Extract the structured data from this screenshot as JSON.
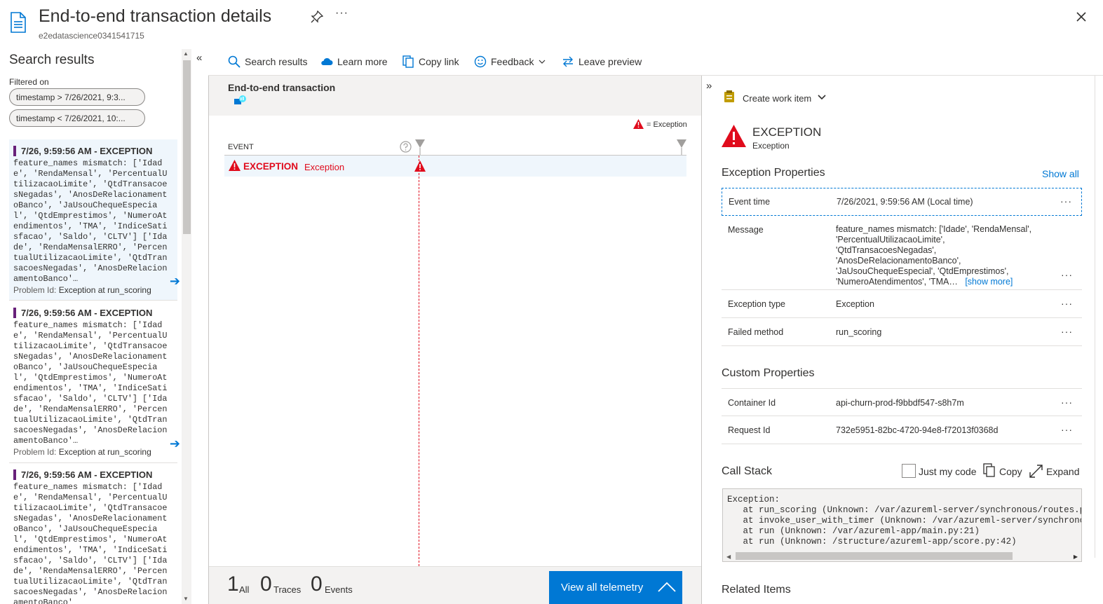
{
  "header": {
    "title": "End-to-end transaction details",
    "subtitle": "e2edatascience0341541715"
  },
  "left_panel": {
    "title": "Search results",
    "filtered_on": "Filtered on",
    "filters": [
      "timestamp > 7/26/2021, 9:3...",
      "timestamp < 7/26/2021, 10:..."
    ],
    "results": [
      {
        "header": "7/26, 9:59:56 AM - EXCEPTION",
        "body": "feature_names mismatch: ['Idad\ne', 'RendaMensal', 'PercentualU\ntilizacaoLimite', 'QtdTransacoe\nsNegadas', 'AnosDeRelacionament\noBanco', 'JaUsouChequeEspecia\nl', 'QtdEmprestimos', 'NumeroAt\nendimentos', 'TMA', 'IndiceSati\nsfacao', 'Saldo', 'CLTV'] ['Ida\nde', 'RendaMensalERRO', 'Percen\ntualUtilizacaoLimite', 'QtdTran\nsacoesNegadas', 'AnosDeRelacion\namentoBanco'…",
        "problem_label": "Problem Id:",
        "problem_value": "Exception at run_scoring"
      },
      {
        "header": "7/26, 9:59:56 AM - EXCEPTION",
        "body": "feature_names mismatch: ['Idad\ne', 'RendaMensal', 'PercentualU\ntilizacaoLimite', 'QtdTransacoe\nsNegadas', 'AnosDeRelacionament\noBanco', 'JaUsouChequeEspecia\nl', 'QtdEmprestimos', 'NumeroAt\nendimentos', 'TMA', 'IndiceSati\nsfacao', 'Saldo', 'CLTV'] ['Ida\nde', 'RendaMensalERRO', 'Percen\ntualUtilizacaoLimite', 'QtdTran\nsacoesNegadas', 'AnosDeRelacion\namentoBanco'…",
        "problem_label": "Problem Id:",
        "problem_value": "Exception at run_scoring"
      },
      {
        "header": "7/26, 9:59:56 AM - EXCEPTION",
        "body": "feature_names mismatch: ['Idad\ne', 'RendaMensal', 'PercentualU\ntilizacaoLimite', 'QtdTransacoe\nsNegadas', 'AnosDeRelacionament\noBanco', 'JaUsouChequeEspecia\nl', 'QtdEmprestimos', 'NumeroAt\nendimentos', 'TMA', 'IndiceSati\nsfacao', 'Saldo', 'CLTV'] ['Ida\nde', 'RendaMensalERRO', 'Percen\ntualUtilizacaoLimite', 'QtdTran\nsacoesNegadas', 'AnosDeRelacion\namentoBanco'",
        "problem_label": "",
        "problem_value": ""
      }
    ]
  },
  "toolbar": {
    "search_results": "Search results",
    "learn_more": "Learn more",
    "copy_link": "Copy link",
    "feedback": "Feedback",
    "leave_preview": "Leave preview"
  },
  "center": {
    "title": "End-to-end transaction",
    "legend": "= Exception",
    "event_col": "EVENT",
    "event_row_label": "EXCEPTION",
    "event_row_type": "Exception"
  },
  "footer": {
    "all_count": "1",
    "all_label": "All",
    "traces_count": "0",
    "traces_label": "Traces",
    "events_count": "0",
    "events_label": "Events",
    "view_all": "View all telemetry"
  },
  "right_panel": {
    "create_work_item": "Create work item",
    "exception_title": "EXCEPTION",
    "exception_sub": "Exception",
    "exception_props_title": "Exception Properties",
    "show_all": "Show all",
    "props": {
      "event_time_key": "Event time",
      "event_time_val": "7/26/2021, 9:59:56 AM (Local time)",
      "message_key": "Message",
      "message_lines": [
        "feature_names mismatch: ['Idade', 'RendaMensal',",
        "'PercentualUtilizacaoLimite',",
        "'QtdTransacoesNegadas',",
        "'AnosDeRelacionamentoBanco',",
        "'JaUsouChequeEspecial', 'QtdEmprestimos',",
        "'NumeroAtendimentos', 'TMA…"
      ],
      "show_more": "[show more]",
      "exception_type_key": "Exception type",
      "exception_type_val": "Exception",
      "failed_method_key": "Failed method",
      "failed_method_val": "run_scoring"
    },
    "custom_props_title": "Custom Properties",
    "custom": {
      "container_key": "Container Id",
      "container_val": "api-churn-prod-f9bbdf547-s8h7m",
      "request_key": "Request Id",
      "request_val": "732e5951-82bc-4720-94e8-f72013f0368d"
    },
    "call_stack_title": "Call Stack",
    "just_my_code": "Just my code",
    "copy": "Copy",
    "expand": "Expand",
    "stack_text": "Exception:\n   at run_scoring (Unknown: /var/azureml-server/synchronous/routes.py:\n   at invoke_user_with_timer (Unknown: /var/azureml-server/synchronous\n   at run (Unknown: /var/azureml-app/main.py:21)\n   at run (Unknown: /structure/azureml-app/score.py:42)",
    "related_items_title": "Related Items"
  },
  "colors": {
    "accent": "#0078d4",
    "exception_red": "#e00b1c",
    "selection": "#eff6fc",
    "result_marker": "#68217a"
  }
}
